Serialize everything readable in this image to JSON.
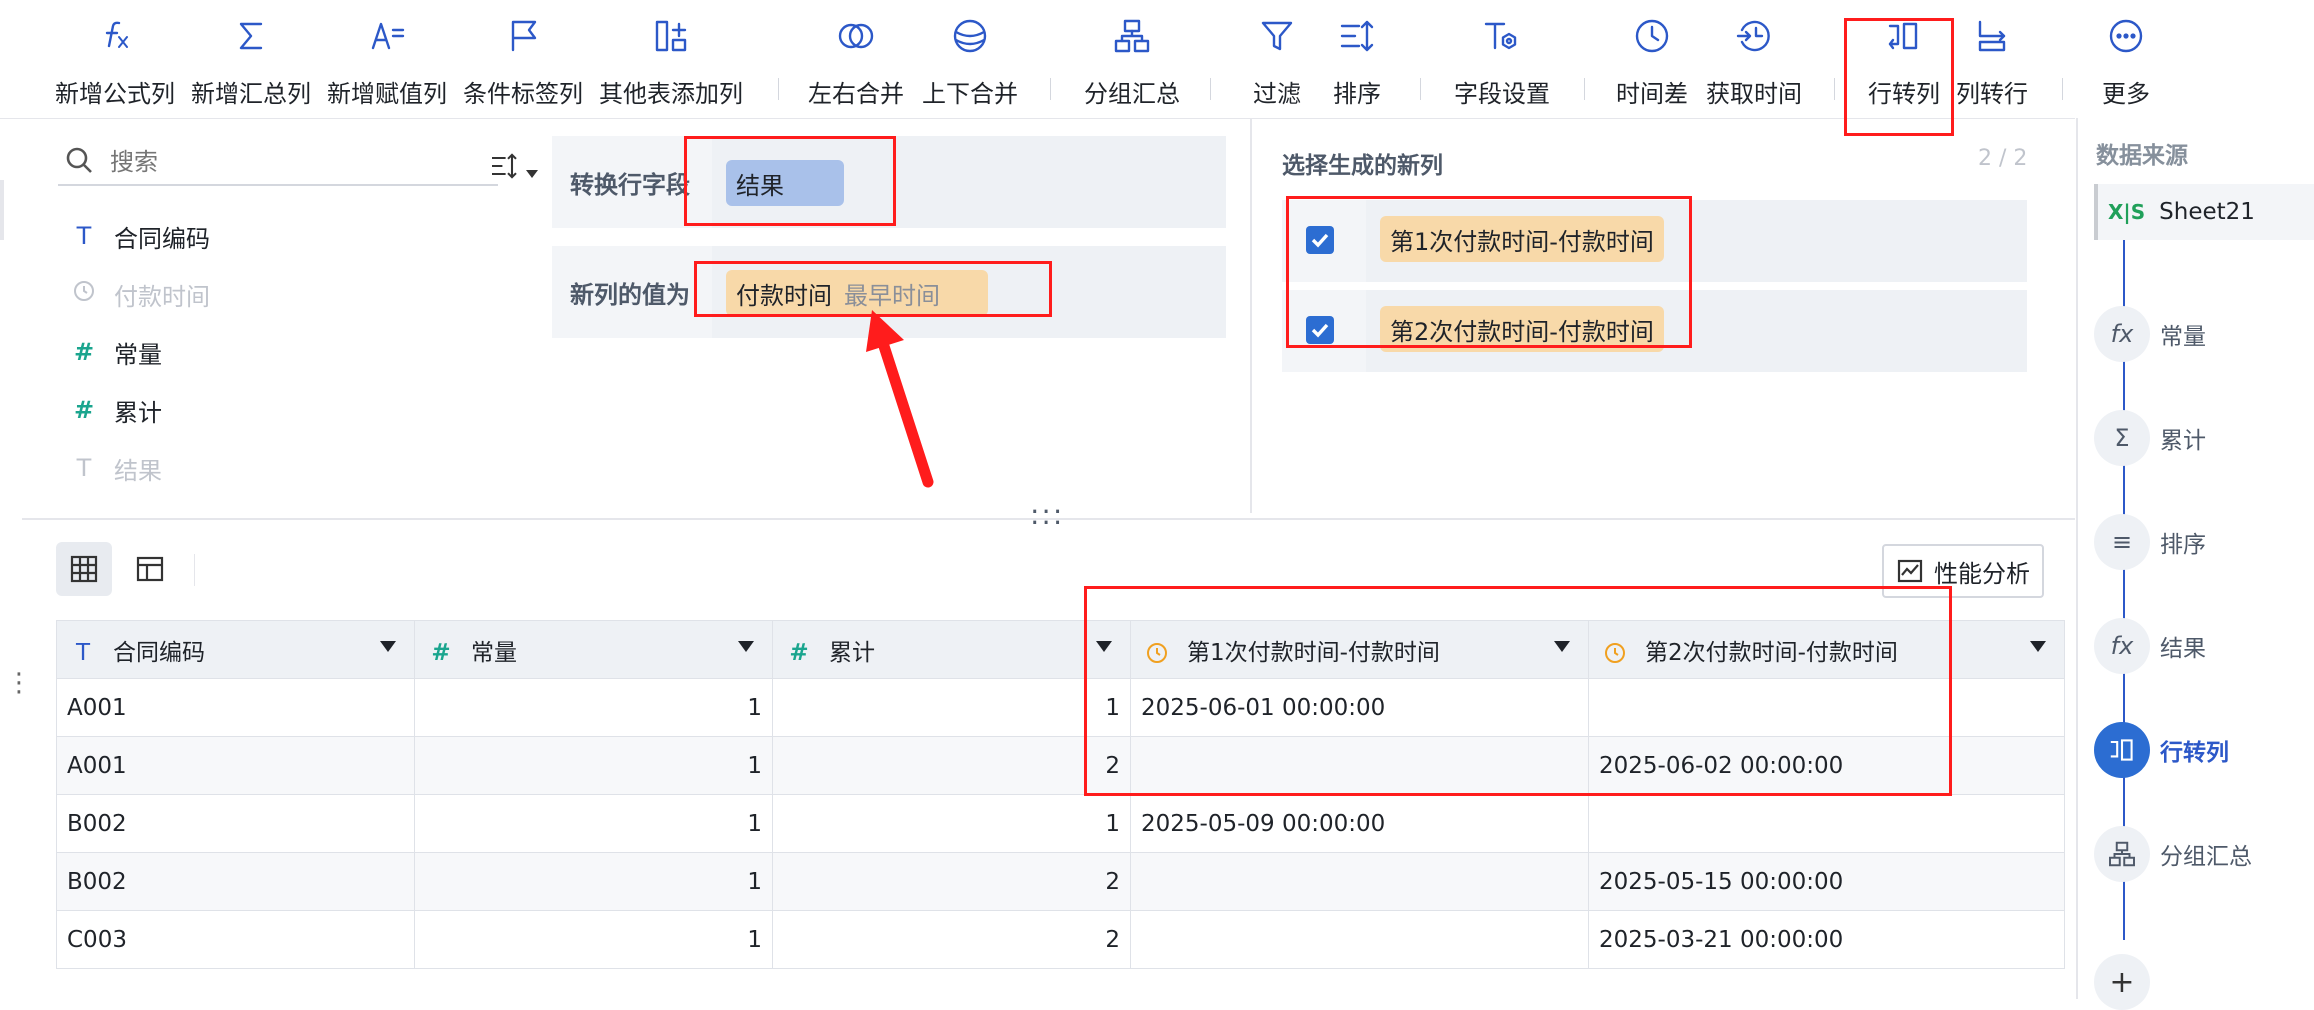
{
  "toolbar": {
    "buttons": [
      {
        "label": "新增公式列",
        "icon": "formula-icon"
      },
      {
        "label": "新增汇总列",
        "icon": "sigma-icon"
      },
      {
        "label": "新增赋值列",
        "icon": "assign-icon"
      },
      {
        "label": "条件标签列",
        "icon": "flag-icon"
      },
      {
        "label": "其他表添加列",
        "icon": "add-column-icon"
      },
      {
        "label": "左右合并",
        "icon": "merge-horizontal-icon"
      },
      {
        "label": "上下合并",
        "icon": "merge-vertical-icon"
      },
      {
        "label": "分组汇总",
        "icon": "group-icon"
      },
      {
        "label": "过滤",
        "icon": "filter-icon"
      },
      {
        "label": "排序",
        "icon": "sort-icon"
      },
      {
        "label": "字段设置",
        "icon": "field-settings-icon"
      },
      {
        "label": "时间差",
        "icon": "clock-icon"
      },
      {
        "label": "获取时间",
        "icon": "clock-arrow-icon"
      },
      {
        "label": "行转列",
        "icon": "row-to-column-icon"
      },
      {
        "label": "列转行",
        "icon": "column-to-row-icon"
      },
      {
        "label": "更多",
        "icon": "more-icon"
      }
    ]
  },
  "fields": {
    "search_placeholder": "搜索",
    "items": [
      {
        "name": "合同编码",
        "type": "text",
        "enabled": true
      },
      {
        "name": "付款时间",
        "type": "time",
        "enabled": false
      },
      {
        "name": "常量",
        "type": "number",
        "enabled": true
      },
      {
        "name": "累计",
        "type": "number",
        "enabled": true
      },
      {
        "name": "结果",
        "type": "text",
        "enabled": false
      }
    ]
  },
  "config": {
    "row_field_label": "转换行字段",
    "row_field_value": "结果",
    "value_label": "新列的值为",
    "value_field": "付款时间",
    "value_agg": "最早时间"
  },
  "new_columns": {
    "title": "选择生成的新列",
    "count": "2 / 2",
    "items": [
      {
        "label": "第1次付款时间-付款时间",
        "checked": true
      },
      {
        "label": "第2次付款时间-付款时间",
        "checked": true
      }
    ]
  },
  "resize_handle": ":::",
  "perf_button": "性能分析",
  "table": {
    "columns": [
      {
        "label": "合同编码",
        "icon": "T",
        "type": "text"
      },
      {
        "label": "常量",
        "icon": "#",
        "type": "number"
      },
      {
        "label": "累计",
        "icon": "#",
        "type": "number"
      },
      {
        "label": "第1次付款时间-付款时间",
        "icon": "clock",
        "type": "time"
      },
      {
        "label": "第2次付款时间-付款时间",
        "icon": "clock",
        "type": "time"
      }
    ],
    "rows": [
      [
        "A001",
        "1",
        "1",
        "2025-06-01 00:00:00",
        ""
      ],
      [
        "A001",
        "1",
        "2",
        "",
        "2025-06-02 00:00:00"
      ],
      [
        "B002",
        "1",
        "1",
        "2025-05-09 00:00:00",
        ""
      ],
      [
        "B002",
        "1",
        "2",
        "",
        "2025-05-15 00:00:00"
      ],
      [
        "C003",
        "1",
        "2",
        "",
        "2025-03-21 00:00:00"
      ]
    ]
  },
  "sidebar": {
    "title": "数据来源",
    "source": "Sheet21",
    "source_icon": "X|S",
    "steps": [
      {
        "label": "常量",
        "icon": "fx",
        "active": false
      },
      {
        "label": "累计",
        "icon": "Σ",
        "active": false
      },
      {
        "label": "排序",
        "icon": "≡↕",
        "active": false
      },
      {
        "label": "结果",
        "icon": "fx",
        "active": false
      },
      {
        "label": "行转列",
        "icon": "row-to-column",
        "active": true
      },
      {
        "label": "分组汇总",
        "icon": "group",
        "active": false
      }
    ],
    "add_label": "+"
  },
  "colors": {
    "accent": "#2c58c8",
    "annotation_red": "#ff1c1c",
    "chip_blue": "#a9c1ea",
    "chip_orange": "#f8d9a9"
  }
}
